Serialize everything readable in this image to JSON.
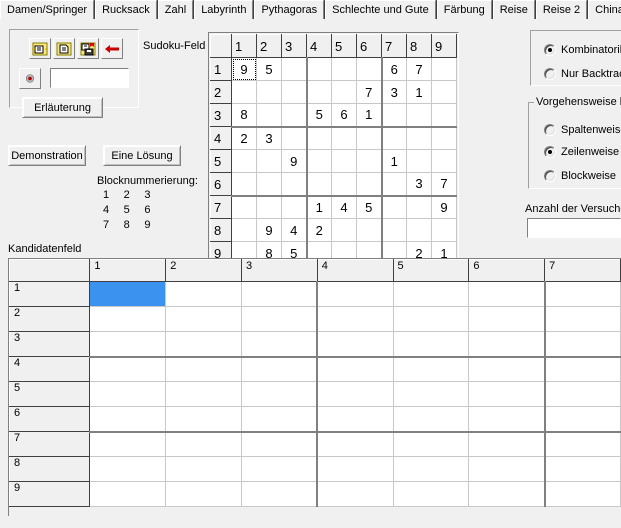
{
  "tabs": [
    {
      "label": "Damen/Springer"
    },
    {
      "label": "Rucksack"
    },
    {
      "label": "Zahl"
    },
    {
      "label": "Labyrinth"
    },
    {
      "label": "Pythagoras"
    },
    {
      "label": "Schlechte und Gute"
    },
    {
      "label": "Färbung"
    },
    {
      "label": "Reise"
    },
    {
      "label": "Reise 2"
    },
    {
      "label": "Chinakisten"
    }
  ],
  "toolbar": {
    "buttons": [
      {
        "icon": "open-folder-icon",
        "title": "Öffnen"
      },
      {
        "icon": "new-document-icon",
        "title": "Neu"
      },
      {
        "icon": "save-disk-icon",
        "title": "Speichern"
      },
      {
        "icon": "red-left-arrow-icon",
        "title": "Zurück"
      }
    ],
    "record_icon": "record-target-icon",
    "record_value": "",
    "record_placeholder": ""
  },
  "buttons": {
    "erlaeuterung": "Erläuterung",
    "demonstration": "Demonstration",
    "eine_loesung": "Eine Lösung"
  },
  "labels": {
    "sudokufeld": "Sudoku-Feld",
    "blocknummerierung": "Blocknummerierung:",
    "kandidatenfeld": "Kandidatenfeld",
    "anzahl_versuche": "Anzahl der Versuche"
  },
  "blocknumbers": [
    "1",
    "2",
    "3",
    "4",
    "5",
    "6",
    "7",
    "8",
    "9"
  ],
  "sudoku": {
    "col_headers": [
      "1",
      "2",
      "3",
      "4",
      "5",
      "6",
      "7",
      "8",
      "9"
    ],
    "row_headers": [
      "1",
      "2",
      "3",
      "4",
      "5",
      "6",
      "7",
      "8",
      "9"
    ],
    "focus_cell": {
      "row": 0,
      "col": 0
    },
    "grid": [
      [
        "9",
        "5",
        "",
        "",
        "",
        "",
        "6",
        "7",
        ""
      ],
      [
        "",
        "",
        "",
        "",
        "",
        "7",
        "3",
        "1",
        ""
      ],
      [
        "8",
        "",
        "",
        "5",
        "6",
        "1",
        "",
        "",
        ""
      ],
      [
        "2",
        "3",
        "",
        "",
        "",
        "",
        "",
        "",
        ""
      ],
      [
        "",
        "",
        "9",
        "",
        "",
        "",
        "1",
        "",
        ""
      ],
      [
        "",
        "",
        "",
        "",
        "",
        "",
        "",
        "3",
        "7"
      ],
      [
        "",
        "",
        "",
        "1",
        "4",
        "5",
        "",
        "",
        "9"
      ],
      [
        "",
        "9",
        "4",
        "2",
        "",
        "",
        "",
        "",
        ""
      ],
      [
        "",
        "8",
        "5",
        "",
        "",
        "",
        "",
        "2",
        "1"
      ]
    ]
  },
  "options": {
    "method": {
      "title": "",
      "items": [
        {
          "label": "Kombinatorik",
          "selected": true
        },
        {
          "label": "Nur Backtracking",
          "selected": false
        }
      ]
    },
    "order": {
      "title": "Vorgehensweise bei",
      "items": [
        {
          "label": "Spaltenweise",
          "selected": false
        },
        {
          "label": "Zeilenweise",
          "selected": true
        },
        {
          "label": "Blockweise",
          "selected": false
        }
      ]
    },
    "attempts_value": "",
    "attempts_placeholder": ""
  },
  "kandidatenfeld": {
    "col_headers": [
      "1",
      "2",
      "3",
      "4",
      "5",
      "6",
      "7"
    ],
    "row_headers": [
      "1",
      "2",
      "3",
      "4",
      "5",
      "6",
      "7",
      "8",
      "9"
    ],
    "selected_cell": {
      "row": 0,
      "col": 0
    },
    "cells": [
      [
        "",
        "",
        "",
        "",
        "",
        "",
        ""
      ],
      [
        "",
        "",
        "",
        "",
        "",
        "",
        ""
      ],
      [
        "",
        "",
        "",
        "",
        "",
        "",
        ""
      ],
      [
        "",
        "",
        "",
        "",
        "",
        "",
        ""
      ],
      [
        "",
        "",
        "",
        "",
        "",
        "",
        ""
      ],
      [
        "",
        "",
        "",
        "",
        "",
        "",
        ""
      ],
      [
        "",
        "",
        "",
        "",
        "",
        "",
        ""
      ],
      [
        "",
        "",
        "",
        "",
        "",
        "",
        ""
      ],
      [
        "",
        "",
        "",
        "",
        "",
        "",
        ""
      ]
    ]
  },
  "colors": {
    "selection_blue": "#3b92ef",
    "window_bg": "#f0f0f0",
    "grid_line": "#c8c8c8",
    "block_line": "#808080"
  }
}
